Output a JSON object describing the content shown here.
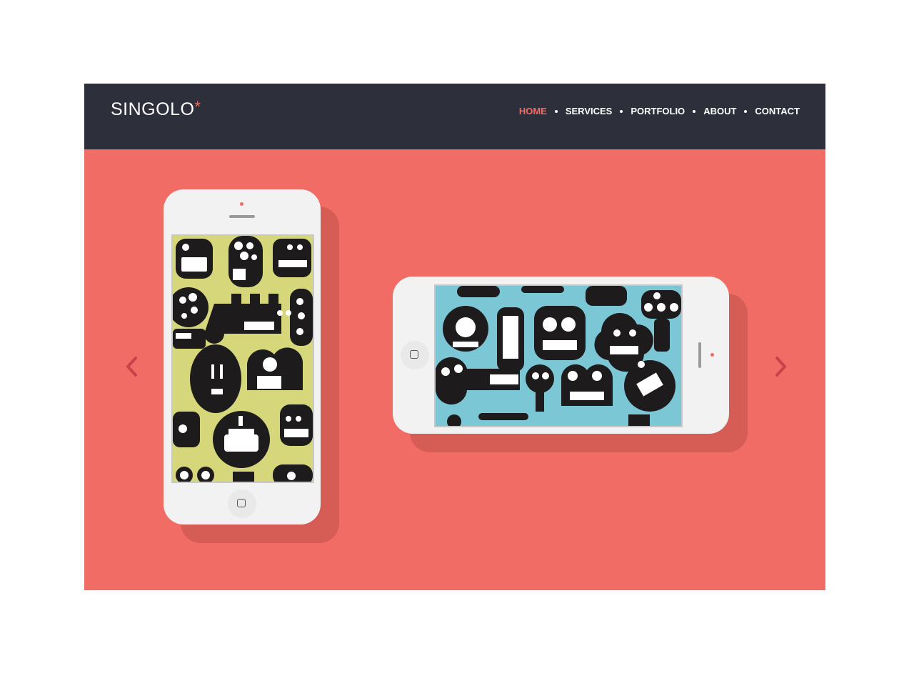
{
  "brand": {
    "name": "SINGOLO",
    "mark": "*"
  },
  "nav": {
    "items": [
      {
        "label": "HOME",
        "active": true
      },
      {
        "label": "SERVICES",
        "active": false
      },
      {
        "label": "PORTFOLIO",
        "active": false
      },
      {
        "label": "ABOUT",
        "active": false
      },
      {
        "label": "CONTACT",
        "active": false
      }
    ]
  },
  "slider": {
    "prev_icon": "chevron-left-icon",
    "next_icon": "chevron-right-icon",
    "devices": [
      {
        "orientation": "vertical",
        "screen_color": "#d6d77a",
        "pattern": "monster-icons"
      },
      {
        "orientation": "horizontal",
        "screen_color": "#7cc7d6",
        "pattern": "monster-icons"
      }
    ]
  },
  "colors": {
    "header_bg": "#2d303a",
    "accent": "#f06c64",
    "hero_bg": "#f06c64",
    "phone_body": "#f2f2f2"
  }
}
